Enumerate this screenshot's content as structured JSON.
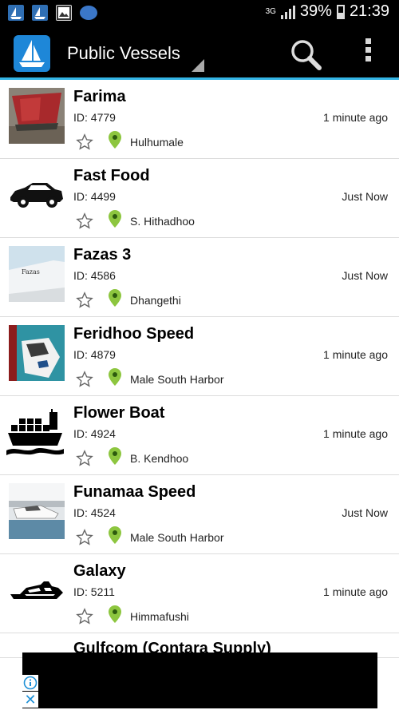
{
  "status_bar": {
    "network": "3G",
    "battery": "39%",
    "time": "21:39"
  },
  "app_bar": {
    "title": "Public Vessels"
  },
  "vessels": [
    {
      "name": "Farima",
      "id": "ID: 4779",
      "time": "1 minute ago",
      "location": "Hulhumale",
      "thumb": "red-ship-photo"
    },
    {
      "name": "Fast Food",
      "id": "ID: 4499",
      "time": "Just Now",
      "location": "S. Hithadhoo",
      "thumb": "car-icon"
    },
    {
      "name": "Fazas 3",
      "id": "ID: 4586",
      "time": "Just Now",
      "location": "Dhangethi",
      "thumb": "boat-photo",
      "thumb_text": "Fazas"
    },
    {
      "name": "Feridhoo Speed",
      "id": "ID: 4879",
      "time": "1 minute ago",
      "location": "Male South Harbor",
      "thumb": "speedboat-photo"
    },
    {
      "name": "Flower Boat",
      "id": "ID: 4924",
      "time": "1 minute ago",
      "location": "B. Kendhoo",
      "thumb": "cargo-ship-icon"
    },
    {
      "name": "Funamaa Speed",
      "id": "ID: 4524",
      "time": "Just Now",
      "location": "Male South Harbor",
      "thumb": "speedboat-harbor-photo"
    },
    {
      "name": "Galaxy",
      "id": "ID: 5211",
      "time": "1 minute ago",
      "location": "Himmafushi",
      "thumb": "yacht-icon"
    }
  ],
  "partial_item": {
    "name": "Gulfcom (Contara Supply)"
  },
  "ad_close_glyph": "✕",
  "colors": {
    "accent": "#33b5e5",
    "pin": "#8dc63f",
    "app_logo": "#1e87d8"
  }
}
